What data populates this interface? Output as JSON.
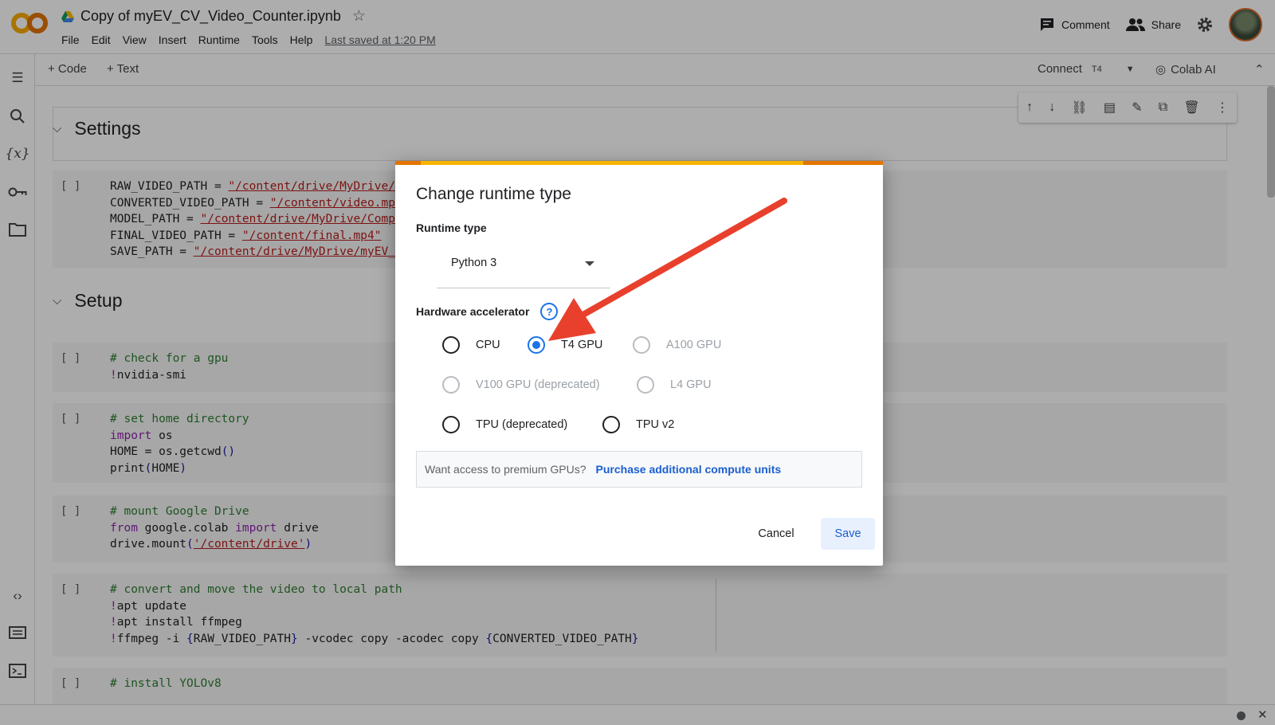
{
  "header": {
    "title": "Copy of myEV_CV_Video_Counter.ipynb",
    "menu": [
      "File",
      "Edit",
      "View",
      "Insert",
      "Runtime",
      "Tools",
      "Help"
    ],
    "last_saved": "Last saved at 1:20 PM",
    "comment_label": "Comment",
    "share_label": "Share"
  },
  "toolbar": {
    "add_code": "+ Code",
    "add_text": "+ Text",
    "connect_label": "Connect",
    "connect_runtime": "T4",
    "colab_ai": "Colab AI"
  },
  "notebook": {
    "sections": [
      "Settings",
      "Setup"
    ],
    "cell_bracket": "[ ]"
  },
  "dialog": {
    "title": "Change runtime type",
    "runtime_type_label": "Runtime type",
    "runtime_type_value": "Python 3",
    "hardware_label": "Hardware accelerator",
    "help_glyph": "?",
    "options": [
      {
        "label": "CPU",
        "state": "enabled"
      },
      {
        "label": "T4 GPU",
        "state": "selected"
      },
      {
        "label": "A100 GPU",
        "state": "disabled"
      },
      {
        "label": "V100 GPU (deprecated)",
        "state": "disabled"
      },
      {
        "label": "L4 GPU",
        "state": "disabled"
      },
      {
        "label": "TPU (deprecated)",
        "state": "enabled"
      },
      {
        "label": "TPU v2",
        "state": "enabled"
      }
    ],
    "premium_question": "Want access to premium GPUs?",
    "premium_link": "Purchase additional compute units",
    "cancel_label": "Cancel",
    "save_label": "Save"
  },
  "colors": {
    "accent": "#1a73e8",
    "annotation_arrow": "#e8402c"
  }
}
